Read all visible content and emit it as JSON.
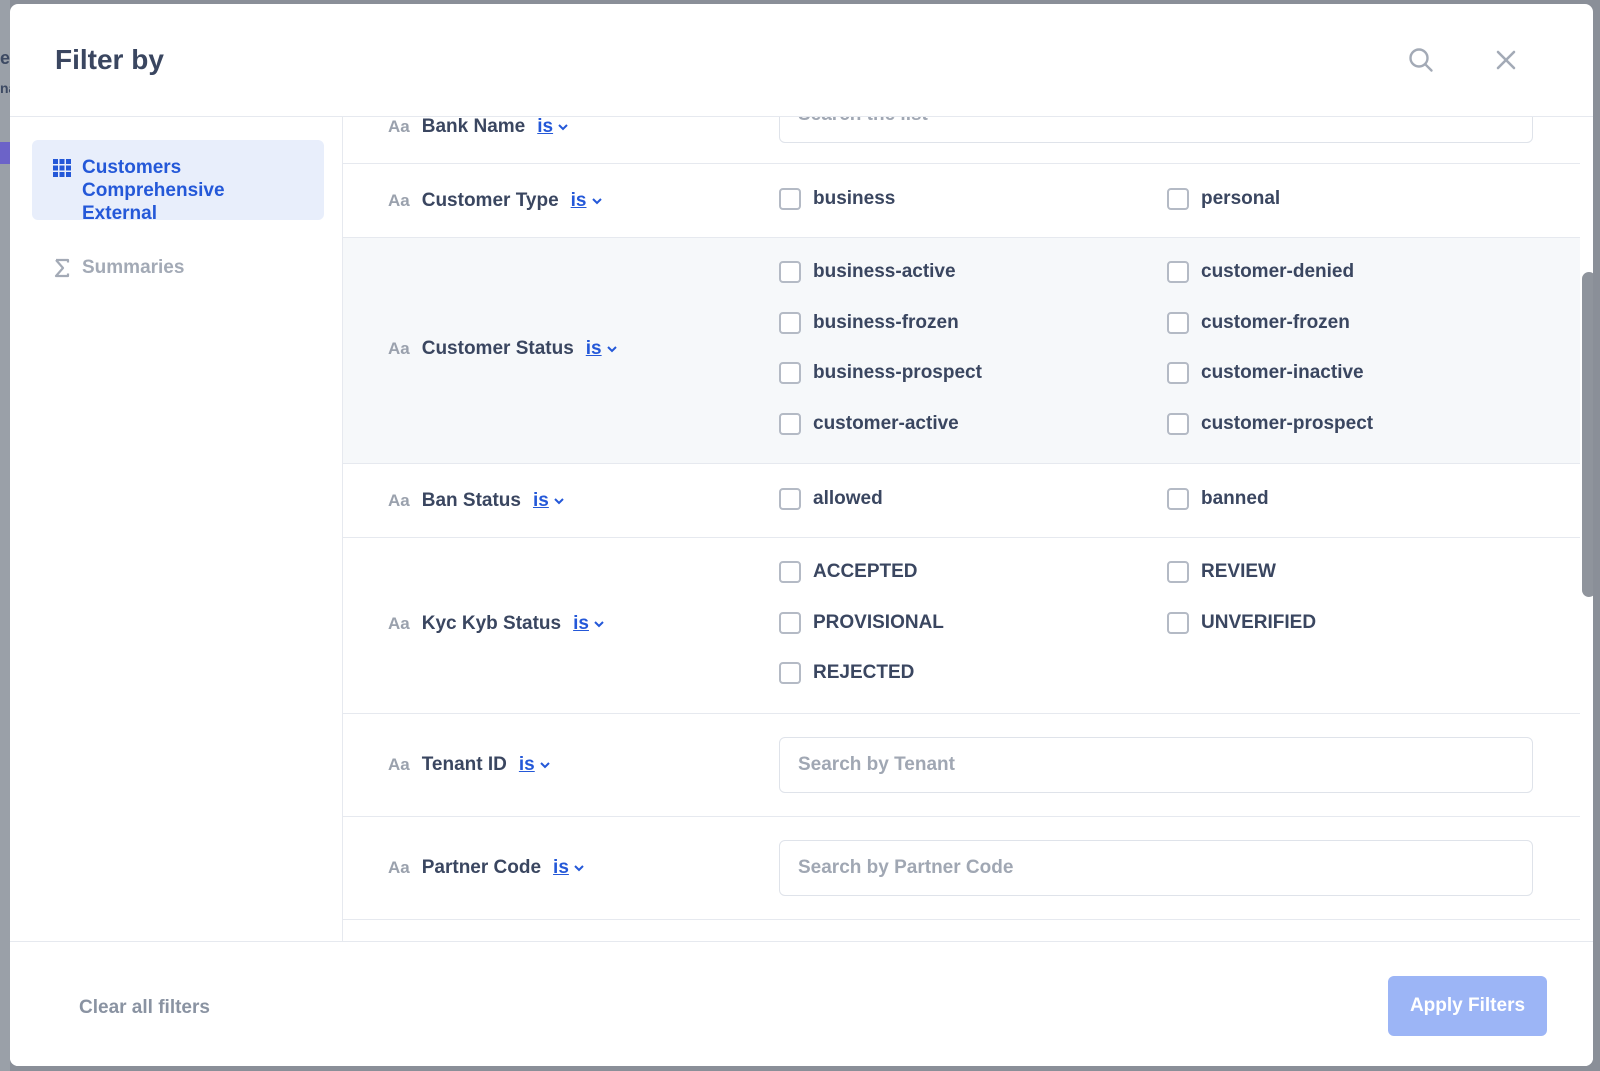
{
  "backdrop": {
    "peek_letter_1": "e",
    "peek_letter_2": "na"
  },
  "header": {
    "title": "Filter by"
  },
  "sidebar": {
    "items": [
      {
        "label": "Customers Comprehensive External",
        "active": true
      },
      {
        "label": "Summaries",
        "active": false
      }
    ]
  },
  "filters": {
    "bank_name": {
      "type_tag": "Aa",
      "label": "Bank Name",
      "operator": "is",
      "placeholder": "Search the list"
    },
    "customer_type": {
      "type_tag": "Aa",
      "label": "Customer Type",
      "operator": "is",
      "options": [
        "business",
        "personal"
      ]
    },
    "customer_status": {
      "type_tag": "Aa",
      "label": "Customer Status",
      "operator": "is",
      "options": [
        "business-active",
        "customer-denied",
        "business-frozen",
        "customer-frozen",
        "business-prospect",
        "customer-inactive",
        "customer-active",
        "customer-prospect"
      ]
    },
    "ban_status": {
      "type_tag": "Aa",
      "label": "Ban Status",
      "operator": "is",
      "options": [
        "allowed",
        "banned"
      ]
    },
    "kyc_kyb_status": {
      "type_tag": "Aa",
      "label": "Kyc Kyb Status",
      "operator": "is",
      "options": [
        "ACCEPTED",
        "REVIEW",
        "PROVISIONAL",
        "UNVERIFIED",
        "REJECTED"
      ]
    },
    "tenant_id": {
      "type_tag": "Aa",
      "label": "Tenant ID",
      "operator": "is",
      "placeholder": "Search by Tenant"
    },
    "partner_code": {
      "type_tag": "Aa",
      "label": "Partner Code",
      "operator": "is",
      "placeholder": "Search by Partner Code"
    }
  },
  "footer": {
    "clear_label": "Clear all filters",
    "apply_label": "Apply Filters"
  },
  "colors": {
    "accent": "#2458d8",
    "apply_disabled": "#9cb5f6",
    "text": "#3a4660"
  },
  "icons": {
    "search": "search-icon",
    "close": "close-icon",
    "table": "table-grid-icon",
    "sigma": "sigma-icon",
    "chevron": "chevron-down-icon"
  }
}
